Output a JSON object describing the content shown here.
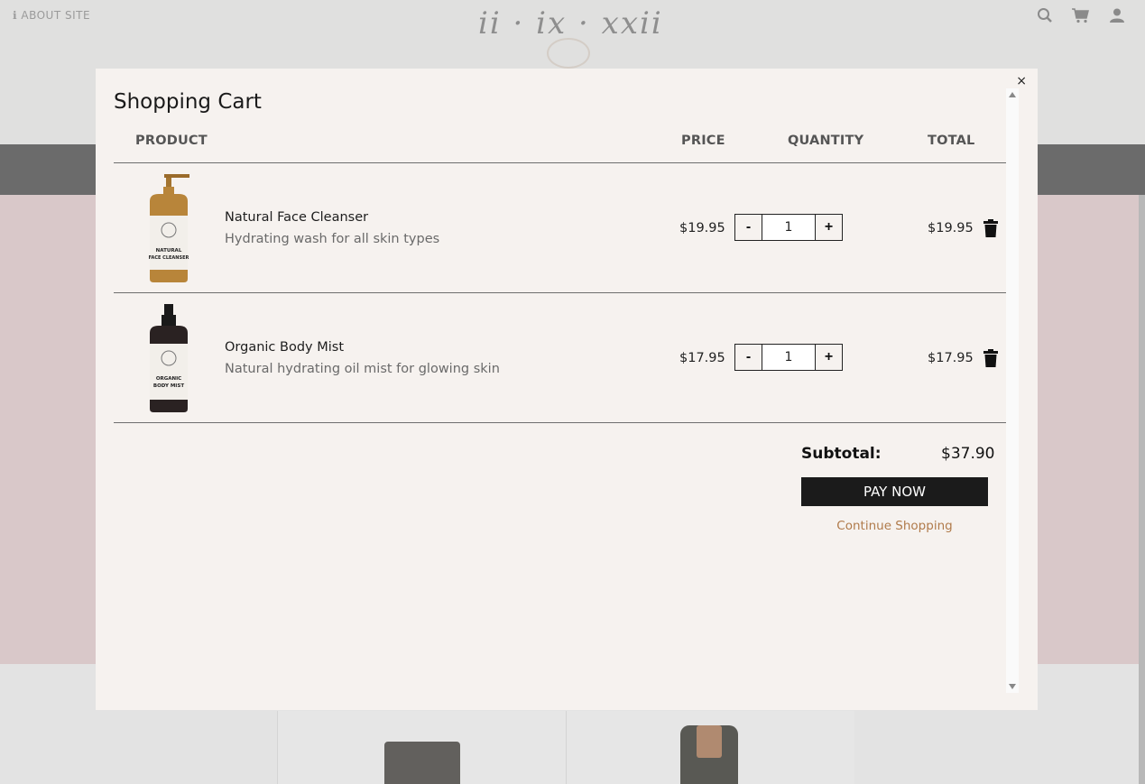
{
  "background": {
    "about_label": "ℹ ABOUT SITE",
    "logo_text": "ii · ix · xxii",
    "icons": [
      "search-icon",
      "cart-icon",
      "user-icon"
    ]
  },
  "cart": {
    "title": "Shopping Cart",
    "close_label": "×",
    "columns": {
      "product": "PRODUCT",
      "price": "PRICE",
      "quantity": "QUANTITY",
      "total": "TOTAL"
    },
    "items": [
      {
        "name": "Natural Face Cleanser",
        "description": "Hydrating wash for all skin types",
        "price": "$19.95",
        "quantity": "1",
        "total": "$19.95",
        "image_label": "NATURAL FACE CLEANSER",
        "bottle_color": "#b8853a"
      },
      {
        "name": "Organic Body Mist",
        "description": "Natural hydrating oil mist for glowing skin",
        "price": "$17.95",
        "quantity": "1",
        "total": "$17.95",
        "image_label": "ORGANIC BODY MIST",
        "bottle_color": "#2a2222"
      }
    ],
    "qty_minus": "-",
    "qty_plus": "+",
    "subtotal_label": "Subtotal:",
    "subtotal_value": "$37.90",
    "pay_label": "PAY NOW",
    "continue_label": "Continue Shopping"
  },
  "colors": {
    "accent_link": "#b07a4a",
    "pay_button": "#1b1b1b",
    "modal_bg": "#f6f2ef"
  }
}
